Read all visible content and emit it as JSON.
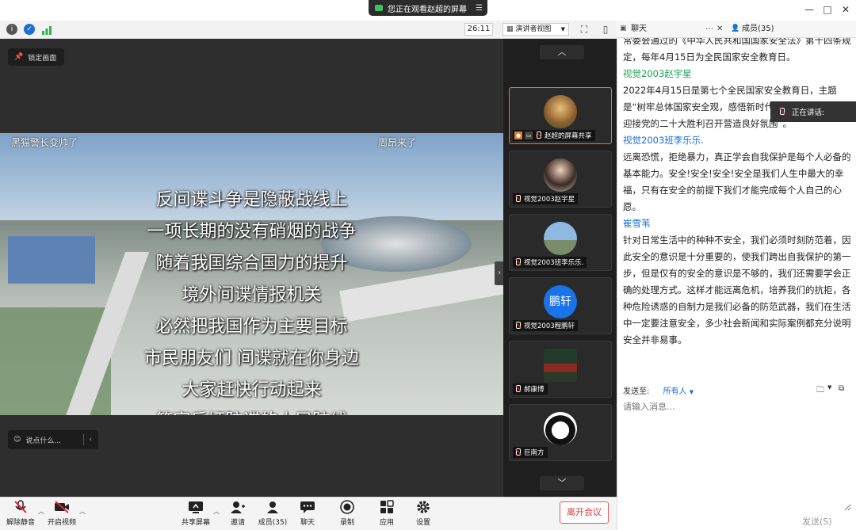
{
  "banner": {
    "text": "您正在观看赵超的屏幕",
    "menu_icon": "list-icon"
  },
  "toolbar": {
    "timer": "26:11",
    "view_mode": "演讲者视图"
  },
  "stage": {
    "pin_label": "锁定画面",
    "overlay_left": "黑猫警长变帅了",
    "overlay_right": "周昂来了",
    "captions": [
      "反间谍斗争是隐蔽战线上",
      "一项长期的没有硝烟的战争",
      "随着我国综合国力的提升",
      "境外间谍情报机关",
      "必然把我国作为主要目标",
      "市民朋友们 间谍就在你身边",
      "大家赶快行动起来",
      "筑牢反奸防谍的人民防线"
    ],
    "comment_placeholder": "说点什么..."
  },
  "participants": [
    {
      "label": "赵超的屏幕共享",
      "avatar": "dog-photo",
      "active": true
    },
    {
      "label": "视觉2003赵宇星",
      "avatar": "person-photo",
      "active": false
    },
    {
      "label": "视觉2003班李乐乐.",
      "avatar": "sky-photo",
      "active": false
    },
    {
      "label": "视觉2003程鹏轩",
      "avatar_text": "鹏轩",
      "active": false
    },
    {
      "label": "郝康博",
      "avatar": "landscape-photo",
      "active": false
    },
    {
      "label": "巨南方",
      "avatar": "cartoon-photo",
      "active": false
    }
  ],
  "chat": {
    "tab_chat": "聊天",
    "tab_members": "成员(35)",
    "speaking_label": "正在讲话:",
    "messages": [
      {
        "sender": "",
        "text": "常委会通过的《中华人民共和国国家安全法》第十四条规定，每年4月15日为全民国家安全教育日。"
      },
      {
        "sender": "视觉2003赵宇星",
        "color": "green",
        "text": "2022年4月15日是第七个全民国家安全教育日，主题是“树牢总体国家安全观，感悟新时代国家安全成就，喜迎接党的二十大胜利召开营造良好氛围”。"
      },
      {
        "sender": "视觉2003班李乐乐.",
        "color": "blue",
        "text": "远离恐慌，拒绝暴力，真正学会自我保护是每个人必备的基本能力。安全!安全!安全!安全是我们人生中最大的幸福，只有在安全的前提下我们才能完成每个人自己的心愿。"
      },
      {
        "sender": "崔雪苇",
        "color": "blue",
        "text": "针对日常生活中的种种不安全，我们必须时刻防范着，因此安全的意识是十分重要的，使我们跨出自我保护的第一步，但是仅有的安全的意识是不够的，我们还需要学会正确的处理方式。这样才能远离危机，培养我们的抗拒，各种危险诱惑的自制力是我们必备的防范武器，我们在生活中一定要注意安全，多少社会新闻和实际案例都充分说明安全并非易事。"
      }
    ],
    "send_to_label": "发送至:",
    "send_to_value": "所有人",
    "input_placeholder": "请输入消息...",
    "send_label": "发送(S)"
  },
  "controls": {
    "mute": "解除静音",
    "video": "开启视频",
    "share": "共享屏幕",
    "invite": "邀请",
    "members": "成员(35)",
    "chat": "聊天",
    "record": "录制",
    "apps": "应用",
    "settings": "设置",
    "leave": "离开会议"
  },
  "colors": {
    "accent_orange": "#e07a2b",
    "leave_red": "#d83a3a",
    "chat_green": "#19a354",
    "chat_blue": "#1b6fd4"
  }
}
